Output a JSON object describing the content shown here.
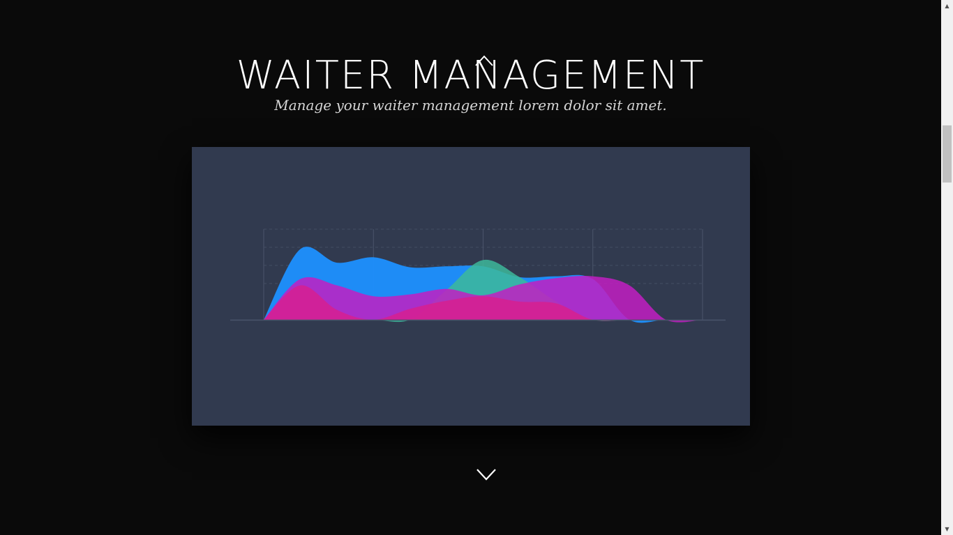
{
  "header": {
    "title": "WAITER MANAGEMENT",
    "subtitle": "Manage your waiter management lorem dolor sit amet."
  },
  "icons": {
    "scroll_up": "chevron-up-icon",
    "scroll_down": "chevron-down-icon",
    "scrollbar_up": "▲",
    "scrollbar_down": "▼"
  },
  "colors": {
    "page_background": "#0a0a0a",
    "panel_background": "#313a4f",
    "blue_series": "#1e90ff",
    "green_series": "#3db89a",
    "magenta_series": "#c21fc2",
    "pink_series": "#d91e8c"
  },
  "chart_data": {
    "type": "area",
    "title": "",
    "xlabel": "",
    "ylabel": "",
    "x": [
      0,
      1,
      2,
      3,
      4,
      5,
      6,
      7,
      8,
      9,
      10,
      11,
      12
    ],
    "xlim": [
      0,
      12
    ],
    "ylim": [
      0,
      100
    ],
    "grid": true,
    "legend": "none",
    "series": [
      {
        "color": "#1e90ff",
        "opacity": 0.95,
        "values": [
          0,
          78,
          63,
          69,
          58,
          59,
          59,
          47,
          48,
          45,
          0,
          0,
          0
        ]
      },
      {
        "color": "#3db89a",
        "opacity": 0.85,
        "values": [
          0,
          0,
          0,
          0,
          0,
          33,
          66,
          47,
          20,
          0,
          0,
          0,
          0
        ]
      },
      {
        "color": "#c21fc2",
        "opacity": 0.85,
        "values": [
          0,
          45,
          38,
          26,
          28,
          34,
          27,
          39,
          46,
          48,
          38,
          0,
          0
        ]
      },
      {
        "color": "#d91e8c",
        "opacity": 0.8,
        "values": [
          0,
          38,
          11,
          0,
          12,
          21,
          26,
          20,
          18,
          0,
          0,
          0,
          0
        ]
      }
    ]
  }
}
